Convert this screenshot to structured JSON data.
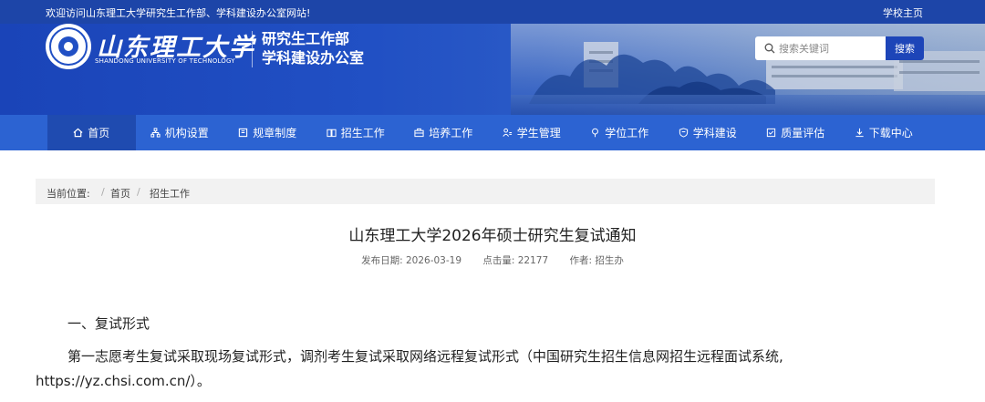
{
  "topbar": {
    "welcome": "欢迎访问山东理工大学研究生工作部、学科建设办公室网站!",
    "home_link": "学校主页"
  },
  "header": {
    "logo_cn": "山东理工大学",
    "logo_en": "SHANDONG UNIVERSITY OF TECHNOLOGY",
    "dept_line1": "研究生工作部",
    "dept_line2": "学科建设办公室",
    "search_placeholder": "搜索关键词",
    "search_button": "搜索"
  },
  "nav": {
    "items": [
      {
        "label": "首页",
        "icon": "home-icon"
      },
      {
        "label": "机构设置",
        "icon": "org-icon"
      },
      {
        "label": "规章制度",
        "icon": "rules-icon"
      },
      {
        "label": "招生工作",
        "icon": "book-icon"
      },
      {
        "label": "培养工作",
        "icon": "briefcase-icon"
      },
      {
        "label": "学生管理",
        "icon": "users-icon"
      },
      {
        "label": "学位工作",
        "icon": "pin-icon"
      },
      {
        "label": "学科建设",
        "icon": "shield-icon"
      },
      {
        "label": "质量评估",
        "icon": "checklist-icon"
      },
      {
        "label": "下载中心",
        "icon": "download-icon"
      }
    ]
  },
  "breadcrumb": {
    "label": "当前位置:",
    "sep": "/",
    "home": "首页",
    "current": "招生工作"
  },
  "article": {
    "title": "山东理工大学2026年硕士研究生复试通知",
    "date": "发布日期: 2026-03-19",
    "hits": "点击量: 22177",
    "author": "作者: 招生办",
    "section1": "一、复试形式",
    "para1": "第一志愿考生复试采取现场复试形式，调剂考生复试采取网络远程复试形式（中国研究生招生信息网招生远程面试系统, https://yz.chsi.com.cn/）。"
  },
  "colors": {
    "topbar": "#1d45a8",
    "nav": "#2c63d2",
    "nav_active": "#1f4bb0",
    "search_button": "#1d45b8"
  }
}
